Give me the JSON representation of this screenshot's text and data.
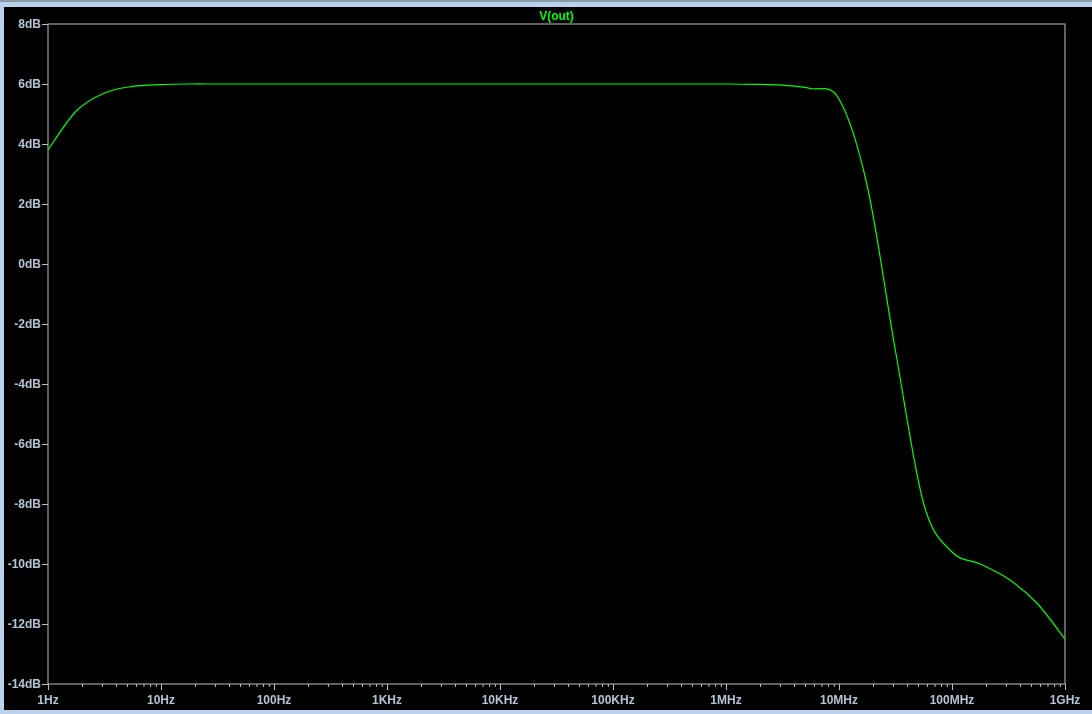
{
  "plot": {
    "chart_data": {
      "type": "line",
      "categories": [
        "1Hz",
        null,
        null,
        null,
        "10Hz",
        null,
        null,
        null,
        "100Hz",
        null,
        null,
        null,
        "1KHz",
        null,
        null,
        null,
        "10KHz",
        null,
        null,
        null,
        "100KHz",
        null,
        null,
        null,
        "1MHz",
        null,
        null,
        null,
        "10MHz",
        null,
        null,
        null,
        "100MHz",
        null,
        null,
        null,
        "1GHz"
      ],
      "series": [
        {
          "name": "V(out)",
          "color": "#00ff00",
          "values": [
            3.8,
            5.1,
            5.7,
            5.92,
            5.98,
            6.0,
            6.0,
            6.0,
            6.0,
            6.0,
            6.0,
            6.0,
            6.0,
            6.0,
            6.0,
            6.0,
            6.0,
            6.0,
            6.0,
            6.0,
            6.0,
            6.0,
            6.0,
            6.0,
            6.0,
            5.99,
            5.96,
            5.85,
            5.5,
            2.6,
            -2.9,
            -8.0,
            -9.6,
            -10.0,
            -10.5,
            -11.3,
            -12.5
          ]
        }
      ],
      "ylim": [
        -14,
        8
      ],
      "yticks": [
        {
          "value": 8,
          "label": "8dB"
        },
        {
          "value": 6,
          "label": "6dB"
        },
        {
          "value": 4,
          "label": "4dB"
        },
        {
          "value": 2,
          "label": "2dB"
        },
        {
          "value": 0,
          "label": "0dB"
        },
        {
          "value": -2,
          "label": "-2dB"
        },
        {
          "value": -4,
          "label": "-4dB"
        },
        {
          "value": -6,
          "label": "-6dB"
        },
        {
          "value": -8,
          "label": "-8dB"
        },
        {
          "value": -10,
          "label": "-10dB"
        },
        {
          "value": -12,
          "label": "-12dB"
        },
        {
          "value": -14,
          "label": "-14dB"
        }
      ]
    }
  }
}
